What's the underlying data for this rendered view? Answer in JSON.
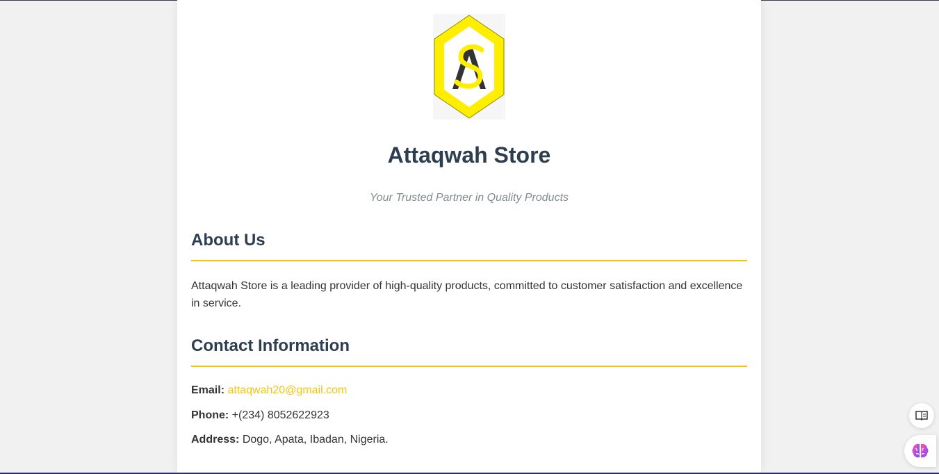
{
  "store": {
    "title": "Attaqwah Store",
    "tagline": "Your Trusted Partner in Quality Products",
    "logo_letters": "AS"
  },
  "about": {
    "heading": "About Us",
    "text": "Attaqwah Store is a leading provider of high-quality products, committed to customer satisfaction and excellence in service."
  },
  "contact": {
    "heading": "Contact Information",
    "email_label": "Email:",
    "email_value": "attaqwah20@gmail.com",
    "phone_label": "Phone:",
    "phone_value": "+(234) 8052622923",
    "address_label": "Address:",
    "address_value": "Dogo, Apata, Ibadan, Nigeria."
  },
  "floating_tools": {
    "reader_icon": "reader-mode-icon",
    "brain_icon": "brain-icon"
  },
  "colors": {
    "accent": "#f1c40f",
    "heading": "#2c3e50",
    "tagline": "#7f8c8d",
    "logo_yellow": "#ffee00"
  }
}
